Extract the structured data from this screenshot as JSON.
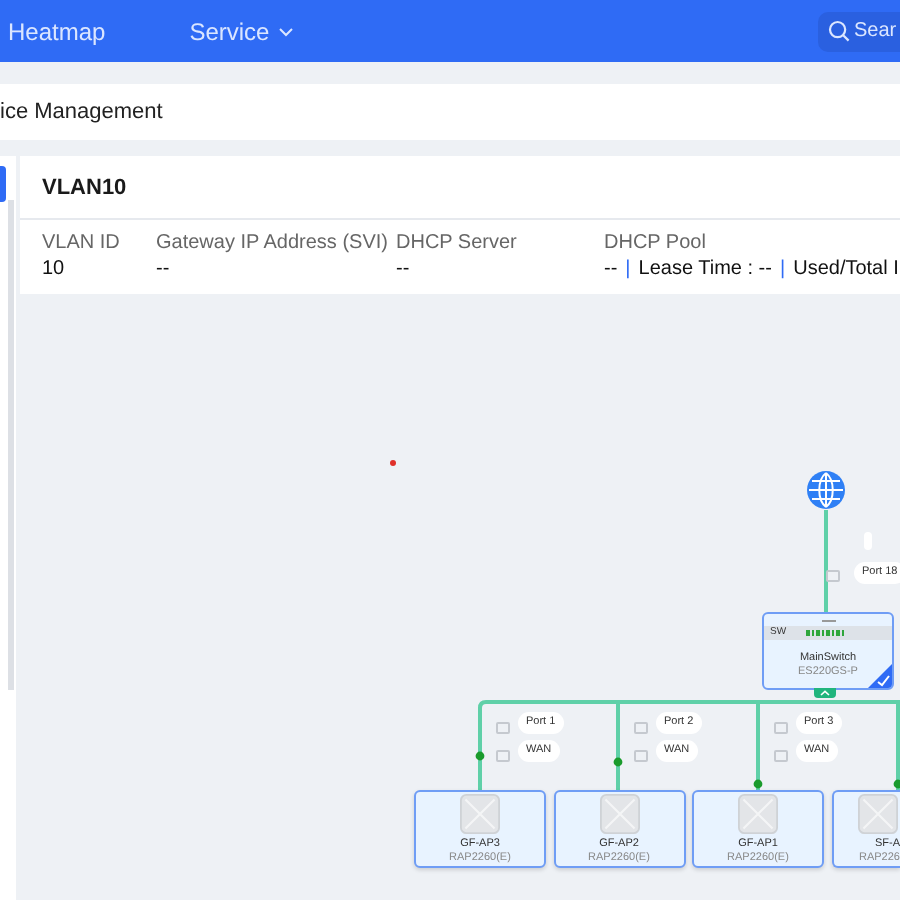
{
  "nav": {
    "items": [
      {
        "label": "Heatmap",
        "dropdown": false
      },
      {
        "label": "Service",
        "dropdown": true
      }
    ],
    "search": {
      "placeholder": "Sear"
    }
  },
  "breadcrumb": "ice Management",
  "vlan": {
    "title": "VLAN10",
    "fields": [
      {
        "label": "VLAN ID",
        "value": "10"
      },
      {
        "label": "Gateway IP Address (SVI)",
        "value": "--"
      },
      {
        "label": "DHCP Server",
        "value": "--"
      },
      {
        "label": "DHCP Pool",
        "parts": [
          "--",
          "Lease Time : --",
          "Used/Total I"
        ],
        "separator": "|"
      }
    ]
  },
  "topology": {
    "uplink": {
      "port": "Port 18"
    },
    "switch": {
      "tag": "SW",
      "name": "MainSwitch",
      "model": "ES220GS-P"
    },
    "aps": [
      {
        "port": "Port 1",
        "uplink": "WAN",
        "name": "GF-AP3",
        "model": "RAP2260(E)"
      },
      {
        "port": "Port 2",
        "uplink": "WAN",
        "name": "GF-AP2",
        "model": "RAP2260(E)"
      },
      {
        "port": "Port 3",
        "uplink": "WAN",
        "name": "GF-AP1",
        "model": "RAP2260(E)"
      },
      {
        "name": "SF-A",
        "model": "RAP226"
      }
    ]
  }
}
